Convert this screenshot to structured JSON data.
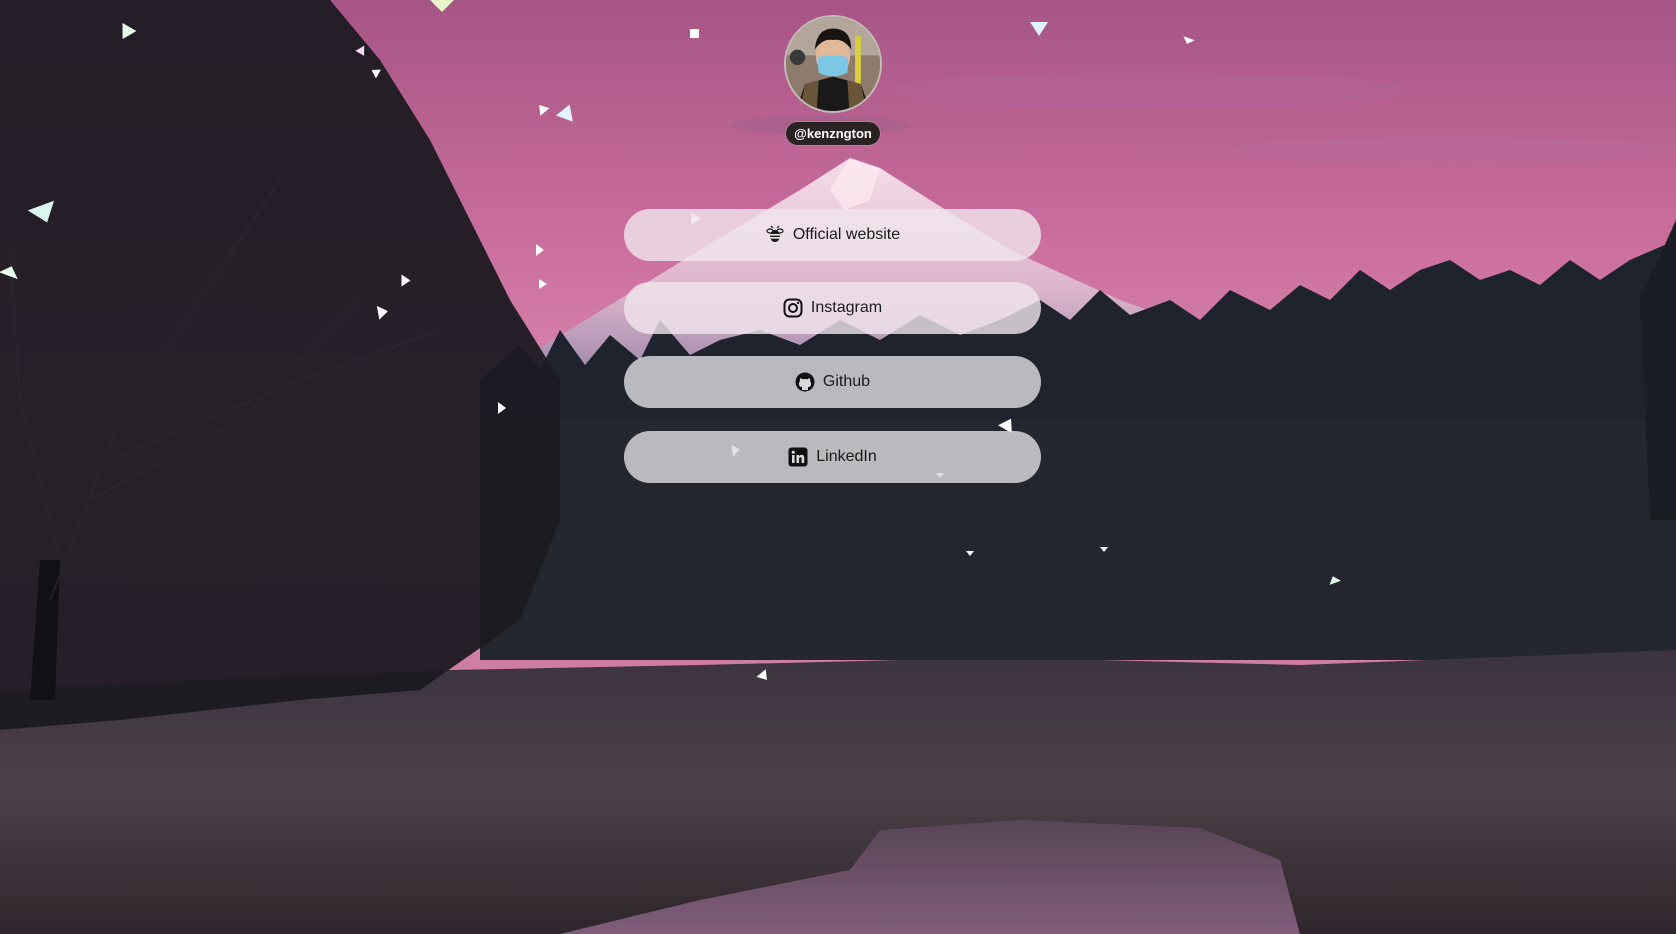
{
  "profile": {
    "handle": "@kenzngton",
    "avatar_icon": "profile-photo-icon"
  },
  "links": [
    {
      "label": "Official website",
      "icon": "bee-icon"
    },
    {
      "label": "Instagram",
      "icon": "instagram-icon"
    },
    {
      "label": "Github",
      "icon": "github-icon"
    },
    {
      "label": "LinkedIn",
      "icon": "linkedin-icon"
    }
  ],
  "background": {
    "sky_top": "#b35a86",
    "sky_mid": "#d77aa5",
    "mountain_snow": "#f2d4e2",
    "forest": "#20242c",
    "field": "#4a3d46",
    "water": "#7a5a74"
  }
}
